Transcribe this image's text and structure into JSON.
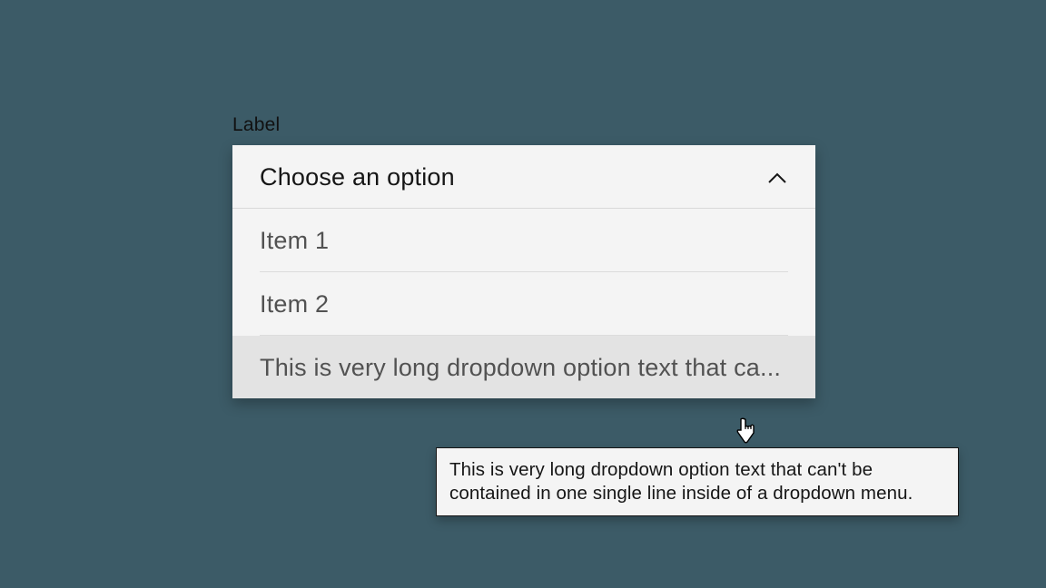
{
  "dropdown": {
    "label": "Label",
    "placeholder": "Choose an option",
    "items": [
      "Item 1",
      "Item 2",
      "This is very long dropdown option text that ca..."
    ]
  },
  "tooltip": {
    "text": "This is very long dropdown option text that can't be contained in one single line inside of a dropdown menu."
  }
}
